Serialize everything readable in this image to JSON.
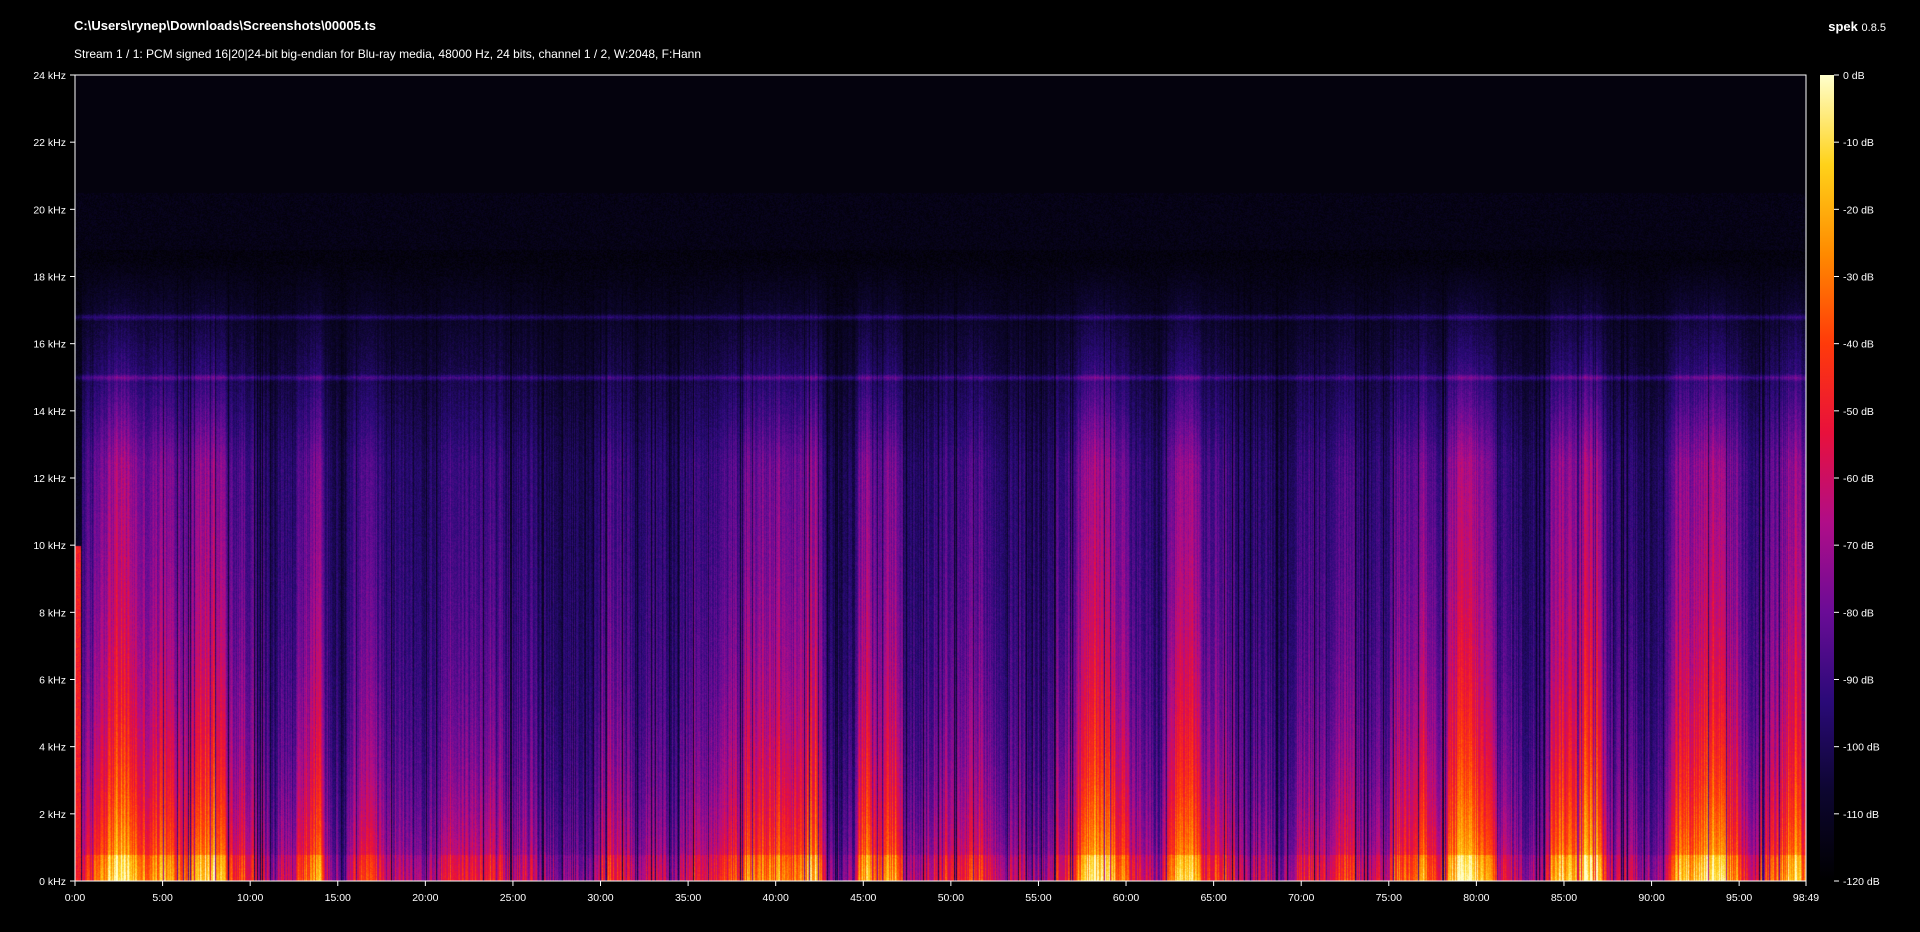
{
  "window": {
    "file_path": "C:\\Users\\rynep\\Downloads\\Screenshots\\00005.ts",
    "stream_info": "Stream 1 / 1: PCM signed 16|20|24-bit big-endian for Blu-ray media, 48000 Hz, 24 bits, channel 1 / 2, W:2048, F:Hann",
    "app_name": "spek",
    "app_version": "0.8.5"
  },
  "colors": {
    "background": "#000000",
    "axis": "#ffffff",
    "palette": [
      "#000000",
      "#0d0630",
      "#2a0a78",
      "#6a0c96",
      "#b00d88",
      "#e8103c",
      "#ff3a0a",
      "#ff8a00",
      "#ffd21a",
      "#ffffcc"
    ]
  },
  "chart_data": {
    "type": "heatmap",
    "title": "",
    "xlabel": "",
    "ylabel": "",
    "x_unit": "time (mm:ss)",
    "duration": "98:49",
    "x_ticks": [
      "0:00",
      "5:00",
      "10:00",
      "15:00",
      "20:00",
      "25:00",
      "30:00",
      "35:00",
      "40:00",
      "45:00",
      "50:00",
      "55:00",
      "60:00",
      "65:00",
      "70:00",
      "75:00",
      "80:00",
      "85:00",
      "90:00",
      "95:00",
      "98:49"
    ],
    "x_tick_minutes": [
      0,
      5,
      10,
      15,
      20,
      25,
      30,
      35,
      40,
      45,
      50,
      55,
      60,
      65,
      70,
      75,
      80,
      85,
      90,
      95,
      98.8167
    ],
    "xlim_minutes": [
      0,
      98.8167
    ],
    "y_ticks": [
      "0 kHz",
      "2 kHz",
      "4 kHz",
      "6 kHz",
      "8 kHz",
      "10 kHz",
      "12 kHz",
      "14 kHz",
      "16 kHz",
      "18 kHz",
      "20 kHz",
      "22 kHz",
      "24 kHz"
    ],
    "y_tick_khz": [
      0,
      2,
      4,
      6,
      8,
      10,
      12,
      14,
      16,
      18,
      20,
      22,
      24
    ],
    "ylim_khz": [
      0,
      24
    ],
    "colorbar": {
      "ticks": [
        "0 dB",
        "-10 dB",
        "-20 dB",
        "-30 dB",
        "-40 dB",
        "-50 dB",
        "-60 dB",
        "-70 dB",
        "-80 dB",
        "-90 dB",
        "-100 dB",
        "-110 dB",
        "-120 dB"
      ],
      "tick_db": [
        0,
        -10,
        -20,
        -30,
        -40,
        -50,
        -60,
        -70,
        -80,
        -90,
        -100,
        -110,
        -120
      ],
      "range_db": [
        -120,
        0
      ]
    },
    "features": {
      "spectral_bands_khz": [
        16.8,
        15.0
      ],
      "high_cutoff_khz": 20.5,
      "loud_segments_minutes": [
        [
          1,
          8.5
        ],
        [
          12.5,
          14
        ],
        [
          38,
          42.5
        ],
        [
          44.5,
          47
        ],
        [
          57,
          60
        ],
        [
          62,
          64
        ],
        [
          75,
          77
        ],
        [
          78,
          81
        ],
        [
          84,
          87
        ],
        [
          91,
          95
        ],
        [
          96,
          98.5
        ]
      ],
      "quiet_gaps_minutes": [
        [
          14,
          15.5
        ],
        [
          27.5,
          29.5
        ],
        [
          42.5,
          44.5
        ]
      ]
    }
  }
}
